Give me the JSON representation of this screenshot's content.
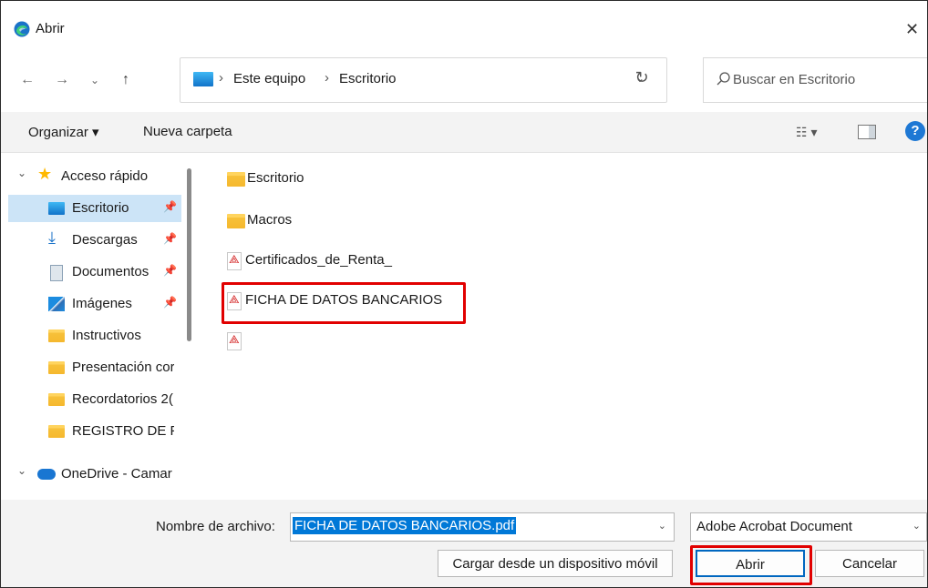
{
  "window": {
    "title": "Abrir",
    "close_glyph": "✕"
  },
  "nav_buttons": {
    "back": "←",
    "forward": "→",
    "recent": "⌄",
    "up": "↑"
  },
  "address": {
    "crumbs": [
      "Este equipo",
      "Escritorio"
    ],
    "separator": "›",
    "dropdown": "⌄",
    "refresh": "↻"
  },
  "search": {
    "placeholder": "Buscar en Escritorio",
    "icon": "search-icon"
  },
  "toolbar": {
    "organize": "Organizar ▾",
    "new_folder": "Nueva carpeta",
    "view": "☷ ▾",
    "help": "?"
  },
  "sidebar": {
    "quick_access": "Acceso rápido",
    "items": [
      {
        "label": "Escritorio",
        "icon": "desktop-icon",
        "pinned": true
      },
      {
        "label": "Descargas",
        "icon": "download-icon",
        "pinned": true
      },
      {
        "label": "Documentos",
        "icon": "documents-icon",
        "pinned": true
      },
      {
        "label": "Imágenes",
        "icon": "pictures-icon",
        "pinned": true
      },
      {
        "label": "Instructivos",
        "icon": "folder-icon",
        "pinned": false
      },
      {
        "label": "Presentación cor",
        "icon": "folder-icon",
        "pinned": false
      },
      {
        "label": "Recordatorios 2(",
        "icon": "folder-icon",
        "pinned": false
      },
      {
        "label": "REGISTRO DE PF",
        "icon": "folder-icon",
        "pinned": false
      }
    ],
    "onedrive": "OneDrive - Camar"
  },
  "files": [
    {
      "name": "Escritorio",
      "type": "folder"
    },
    {
      "name": "Macros",
      "type": "folder"
    },
    {
      "name": "Certificados_de_Renta_",
      "type": "pdf"
    },
    {
      "name": "FICHA DE DATOS BANCARIOS",
      "type": "pdf",
      "highlighted": true
    },
    {
      "name": "",
      "type": "pdf"
    }
  ],
  "footer": {
    "filename_label": "Nombre de archivo:",
    "filename_value": "FICHA DE DATOS BANCARIOS.pdf",
    "filetype": "Adobe Acrobat Document",
    "mobile_button": "Cargar desde un dispositivo móvil",
    "open_button": "Abrir",
    "cancel_button": "Cancelar"
  },
  "colors": {
    "accent": "#0078d7",
    "highlight": "#e10000",
    "selection": "#cce4f7"
  }
}
